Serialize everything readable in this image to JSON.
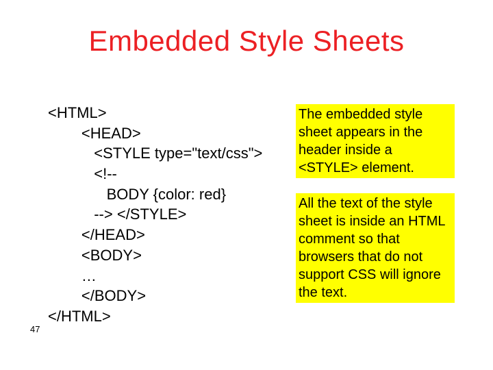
{
  "title": "Embedded Style Sheets",
  "code": {
    "l1": "<HTML>",
    "l2": "        <HEAD>",
    "l3": "           <STYLE type=\"text/css\">",
    "l4": "           <!--",
    "l5": "              BODY {color: red}",
    "l6": "           --> </STYLE>",
    "l7": "        </HEAD>",
    "l8": "        <BODY>",
    "l9": "        …",
    "l10": "        </BODY>",
    "l11": "</HTML>"
  },
  "notes": {
    "n1": "The embedded style sheet appears in the header inside a <STYLE> element.",
    "n2": "All the text of the style sheet is inside an HTML comment so that browsers that do not support CSS will ignore the text."
  },
  "page": "47"
}
